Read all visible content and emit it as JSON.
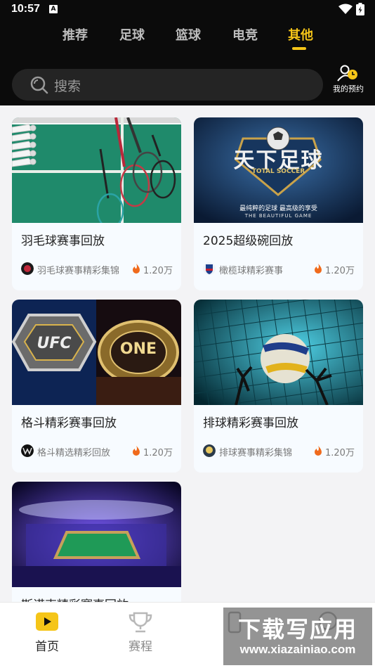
{
  "status_bar": {
    "time": "10:57",
    "notification_badge": "A"
  },
  "tabs": [
    {
      "label": "推荐",
      "active": false
    },
    {
      "label": "足球",
      "active": false
    },
    {
      "label": "篮球",
      "active": false
    },
    {
      "label": "电竞",
      "active": false
    },
    {
      "label": "其他",
      "active": true
    }
  ],
  "search": {
    "placeholder": "搜索"
  },
  "booking": {
    "label": "我的预约",
    "icon": "user-clock-icon"
  },
  "cards": [
    {
      "title": "羽毛球赛事回放",
      "channel": "羽毛球赛事精彩集锦",
      "views": "1.20万",
      "image": "badminton-rackets-and-shuttlecocks"
    },
    {
      "title": "2025超级碗回放",
      "channel": "橄榄球精彩赛事",
      "views": "1.20万",
      "image": "total-soccer-logo",
      "image_text": {
        "main": "天下足球",
        "sub": "TOTAL SOCCER",
        "slogan": "最纯粹的足球 最高级的享受",
        "slogan_en": "THE BEAUTIFUL GAME"
      }
    },
    {
      "title": "格斗精彩赛事回放",
      "channel": "格斗精选精彩回放",
      "views": "1.20万",
      "image": "ufc-and-one-championship-belts",
      "image_text": {
        "left": "UFC",
        "right": "ONE"
      }
    },
    {
      "title": "排球精彩赛事回放",
      "channel": "排球赛事精彩集锦",
      "views": "1.20万",
      "image": "volleyball-at-net"
    },
    {
      "title": "斯诺克精彩赛事回放",
      "channel": "",
      "views": "",
      "image": "snooker-arena"
    }
  ],
  "bottom_nav": [
    {
      "label": "首页",
      "icon": "play-icon",
      "active": true
    },
    {
      "label": "赛程",
      "icon": "trophy-icon",
      "active": false
    },
    {
      "label": "",
      "icon": "phone-icon",
      "active": false
    },
    {
      "label": "",
      "icon": "profile-icon",
      "active": false
    }
  ],
  "watermark": {
    "main": "下载写应用",
    "sub": "www.xiazainiao.com"
  },
  "colors": {
    "accent": "#f5c518",
    "header_bg": "#0b0b0b",
    "page_bg": "#f3f3f5"
  }
}
